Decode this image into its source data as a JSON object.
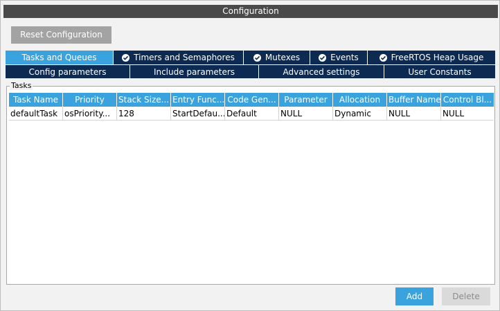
{
  "window": {
    "title": "Configuration"
  },
  "toolbar": {
    "reset_label": "Reset Configuration"
  },
  "tabs_top": [
    {
      "label": "Tasks and Queues",
      "checked": false,
      "active": true
    },
    {
      "label": "Timers and Semaphores",
      "checked": true,
      "active": false
    },
    {
      "label": "Mutexes",
      "checked": true,
      "active": false
    },
    {
      "label": "Events",
      "checked": true,
      "active": false
    },
    {
      "label": "FreeRTOS Heap Usage",
      "checked": true,
      "active": false
    }
  ],
  "tabs_bottom": [
    {
      "label": "Config parameters"
    },
    {
      "label": "Include parameters"
    },
    {
      "label": "Advanced settings"
    },
    {
      "label": "User Constants"
    }
  ],
  "tasks_group": {
    "legend": "Tasks",
    "columns": [
      "Task Name",
      "Priority",
      "Stack Size...",
      "Entry Func...",
      "Code Gen...",
      "Parameter",
      "Allocation",
      "Buffer Name",
      "Control Bl..."
    ],
    "rows": [
      [
        "defaultTask",
        "osPriority...",
        "128",
        "StartDefau...",
        "Default",
        "NULL",
        "Dynamic",
        "NULL",
        "NULL"
      ]
    ]
  },
  "actions": {
    "add_label": "Add",
    "delete_label": "Delete"
  },
  "colors": {
    "accent": "#3aa3dd",
    "tab_dark": "#0c2a52",
    "titlebar": "#4a4a4a",
    "reset_button": "#a3a3a3"
  }
}
